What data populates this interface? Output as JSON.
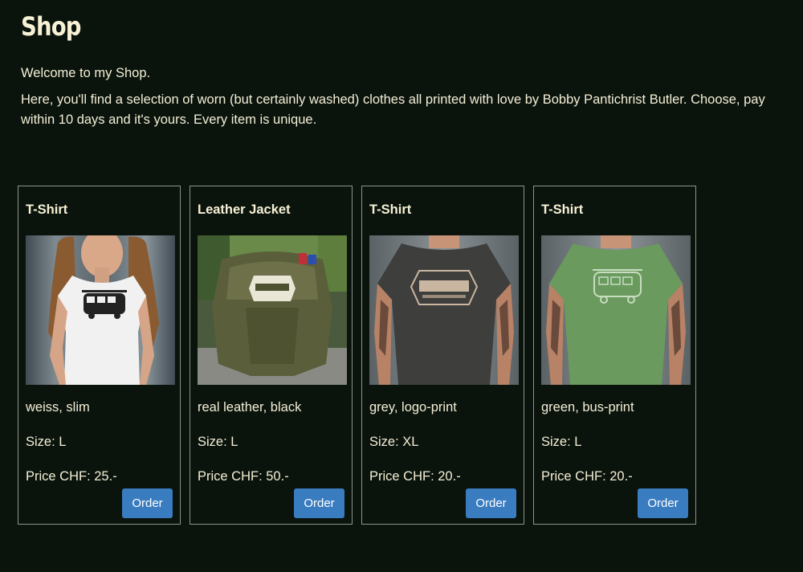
{
  "header": {
    "title": "Shop"
  },
  "intro": {
    "welcome": "Welcome to my Shop.",
    "description": "Here, you'll find a selection of worn (but certainly washed) clothes all printed with love by Bobby Pantichrist Butler. Choose, pay within 10 days and it's yours. Every item is unique."
  },
  "products": [
    {
      "title": "T-Shirt",
      "description": "weiss, slim",
      "size": "Size: L",
      "price": "Price CHF: 25.-",
      "order_label": "Order",
      "image": "white-tshirt-bus-print-photo"
    },
    {
      "title": "Leather Jacket",
      "description": "real leather, black",
      "size": "Size: L",
      "price": "Price CHF: 50.-",
      "order_label": "Order",
      "image": "leather-jacket-beglinger-print-photo"
    },
    {
      "title": "T-Shirt",
      "description": "grey, logo-print",
      "size": "Size: XL",
      "price": "Price CHF: 20.-",
      "order_label": "Order",
      "image": "grey-tshirt-beglinger-logo-photo"
    },
    {
      "title": "T-Shirt",
      "description": "green, bus-print",
      "size": "Size: L",
      "price": "Price CHF: 20.-",
      "order_label": "Order",
      "image": "green-tshirt-bus-print-photo"
    }
  ],
  "colors": {
    "background": "#0a130c",
    "text": "#f4efd6",
    "card_border": "#8e948a",
    "button": "#3a7cc0"
  }
}
